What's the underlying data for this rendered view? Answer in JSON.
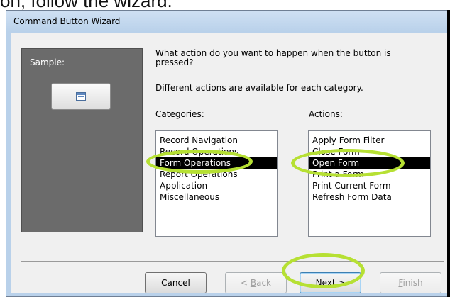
{
  "background": {
    "caption": "on, follow the wizard."
  },
  "window": {
    "title": "Command Button Wizard"
  },
  "sample": {
    "label": "Sample:",
    "button_icon": "form-icon"
  },
  "instructions": {
    "question": "What action do you want to happen when the button is pressed?",
    "hint": "Different actions are available for each category."
  },
  "categories": {
    "label_prefix": "",
    "label_underline": "C",
    "label_rest": "ategories:",
    "items": [
      "Record Navigation",
      "Record Operations",
      "Form Operations",
      "Report Operations",
      "Application",
      "Miscellaneous"
    ],
    "selected": "Form Operations"
  },
  "actions": {
    "label_underline": "A",
    "label_rest": "ctions:",
    "items": [
      "Apply Form Filter",
      "Close Form",
      "Open Form",
      "Print a Form",
      "Print Current Form",
      "Refresh Form Data"
    ],
    "selected": "Open Form"
  },
  "buttons": {
    "cancel": "Cancel",
    "back_prefix": "< ",
    "back_underline": "B",
    "back_rest": "ack",
    "next_underline": "N",
    "next_rest": "ext >",
    "finish_underline": "F",
    "finish_rest": "inish"
  },
  "colors": {
    "highlight": "#b6e033",
    "selection": "#000000"
  }
}
